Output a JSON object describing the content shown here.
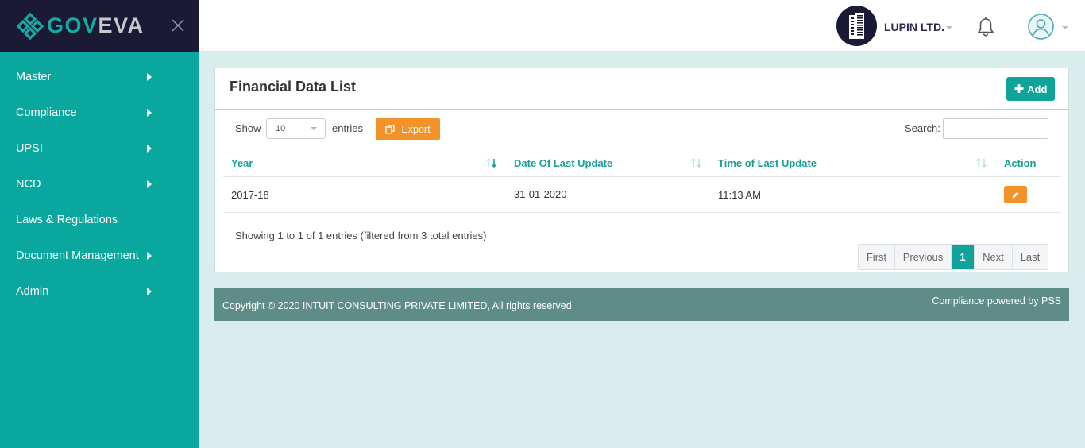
{
  "brand": {
    "logo_text_a": "GOV",
    "logo_text_b": "EVA",
    "colors": {
      "sidebar": "#09a79e",
      "logo_bar": "#1b1a35",
      "accent": "#0fa39a",
      "orange": "#f4922a",
      "footer": "#5e8c86"
    }
  },
  "sidebar": {
    "items": [
      {
        "label": "Master",
        "has_submenu": true
      },
      {
        "label": "Compliance",
        "has_submenu": true
      },
      {
        "label": "UPSI",
        "has_submenu": true
      },
      {
        "label": "NCD",
        "has_submenu": true
      },
      {
        "label": "Laws & Regulations",
        "has_submenu": false
      },
      {
        "label": "Document Management",
        "has_submenu": true
      },
      {
        "label": "Admin",
        "has_submenu": true
      }
    ]
  },
  "topbar": {
    "company_name": "LUPIN LTD.",
    "icons": [
      "building-icon",
      "bell-icon",
      "user-avatar-icon"
    ]
  },
  "card": {
    "title": "Financial Data List",
    "add_label": "Add",
    "show_label": "Show",
    "page_length": "10",
    "entries_label": "entries",
    "export_label": "Export",
    "search_label": "Search:",
    "search_value": ""
  },
  "table": {
    "columns": [
      "Year",
      "Date Of Last Update",
      "Time of Last Update",
      "Action"
    ],
    "rows": [
      {
        "year": "2017-18",
        "date": "31-01-2020",
        "time": "11:13 AM"
      }
    ],
    "info": "Showing 1 to 1 of 1 entries (filtered from 3 total entries)"
  },
  "pagination": {
    "first": "First",
    "previous": "Previous",
    "current": "1",
    "next": "Next",
    "last": "Last"
  },
  "footer": {
    "copyright": "Copyright © 2020 INTUIT CONSULTING PRIVATE LIMITED, All rights reserved",
    "powered": "Compliance powered by PSS"
  }
}
